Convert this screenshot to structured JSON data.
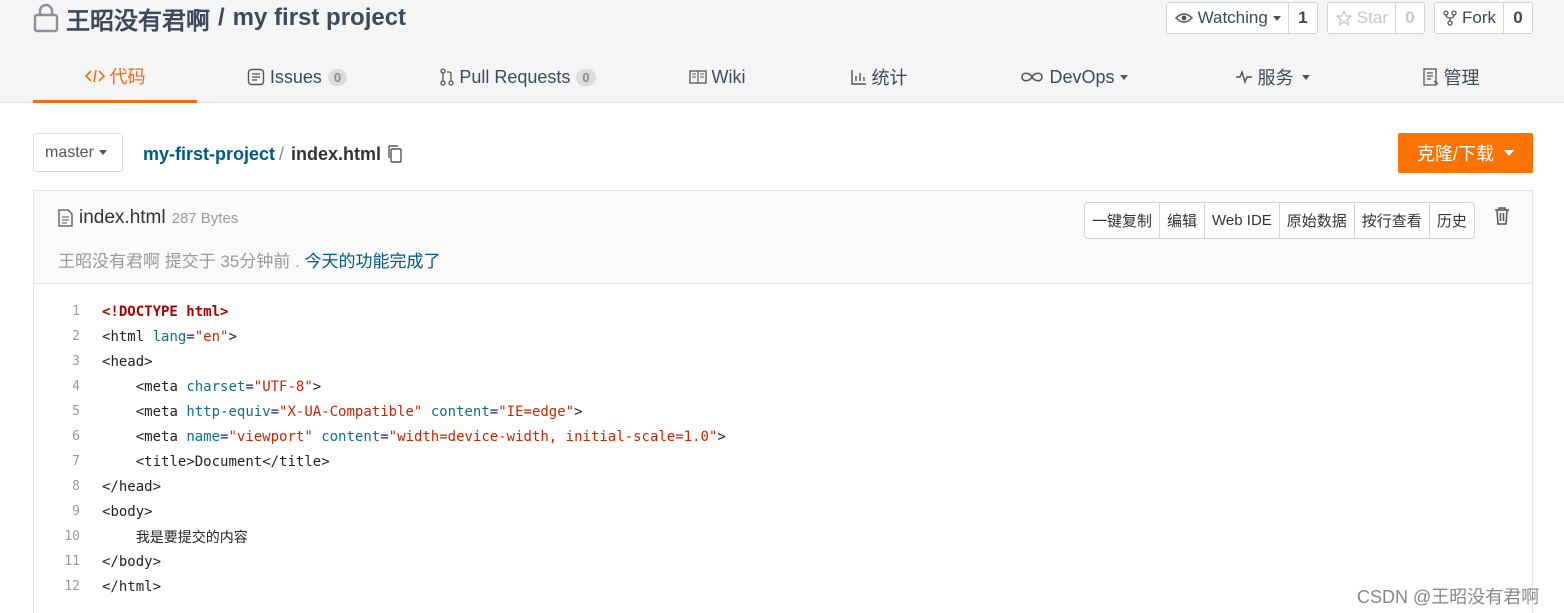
{
  "repo": {
    "owner": "王昭没有君啊",
    "separator": "/",
    "name": "my first project"
  },
  "actions": {
    "watch": {
      "label": "Watching",
      "count": "1"
    },
    "star": {
      "label": "Star",
      "count": "0"
    },
    "fork": {
      "label": "Fork",
      "count": "0"
    }
  },
  "tabs": [
    {
      "label": "代码",
      "icon": "code-icon"
    },
    {
      "label": "Issues",
      "badge": "0",
      "icon": "issues-icon"
    },
    {
      "label": "Pull Requests",
      "badge": "0",
      "icon": "pull-request-icon"
    },
    {
      "label": "Wiki",
      "icon": "wiki-icon"
    },
    {
      "label": "统计",
      "icon": "stats-icon"
    },
    {
      "label": "DevOps",
      "icon": "infinity-icon"
    },
    {
      "label": "服务",
      "icon": "pulse-icon"
    },
    {
      "label": "管理",
      "icon": "manage-icon"
    }
  ],
  "branch": "master",
  "breadcrumb": {
    "project": "my-first-project",
    "sep": "/",
    "file": "index.html"
  },
  "clone_label": "克隆/下载",
  "file": {
    "name": "index.html",
    "size": "287 Bytes",
    "commit_author": "王昭没有君啊",
    "commit_meta": "提交于 35分钟前 .",
    "commit_message": "今天的功能完成了",
    "buttons": [
      "一键复制",
      "编辑",
      "Web IDE",
      "原始数据",
      "按行查看",
      "历史"
    ]
  },
  "code_lines": [
    {
      "n": "1",
      "text": "<!DOCTYPE html>"
    },
    {
      "n": "2",
      "text": "<html lang=\"en\">"
    },
    {
      "n": "3",
      "text": "<head>"
    },
    {
      "n": "4",
      "text": "    <meta charset=\"UTF-8\">"
    },
    {
      "n": "5",
      "text": "    <meta http-equiv=\"X-UA-Compatible\" content=\"IE=edge\">"
    },
    {
      "n": "6",
      "text": "    <meta name=\"viewport\" content=\"width=device-width, initial-scale=1.0\">"
    },
    {
      "n": "7",
      "text": "    <title>Document</title>"
    },
    {
      "n": "8",
      "text": "</head>"
    },
    {
      "n": "9",
      "text": "<body>"
    },
    {
      "n": "10",
      "text": "    我是要提交的内容"
    },
    {
      "n": "11",
      "text": "</body>"
    },
    {
      "n": "12",
      "text": "</html>"
    }
  ],
  "watermark": "CSDN @王昭没有君啊",
  "colors": {
    "accent": "#f26b11",
    "clone_button": "#fe7300",
    "link": "#005980"
  }
}
